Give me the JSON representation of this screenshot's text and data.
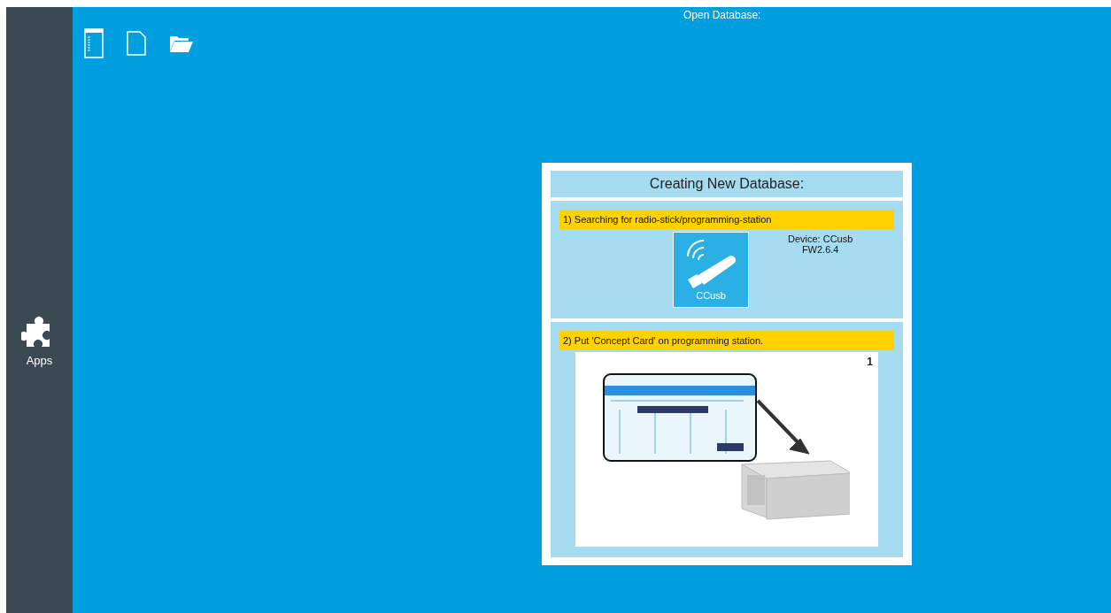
{
  "sidebar": {
    "items": [
      {
        "label": "Apps"
      }
    ]
  },
  "toolbar": {
    "title": "Open Database:"
  },
  "dialog": {
    "title": "Creating New Database:",
    "steps": [
      {
        "kind": "device",
        "label": "1) Searching for radio-stick/programming-station",
        "device_tile": "CCusb",
        "device_info": [
          "Device: CCusb",
          "FW2.6.4"
        ]
      },
      {
        "kind": "illustration",
        "label": "2) Put 'Concept Card' on programming station.",
        "page": "1"
      }
    ]
  }
}
